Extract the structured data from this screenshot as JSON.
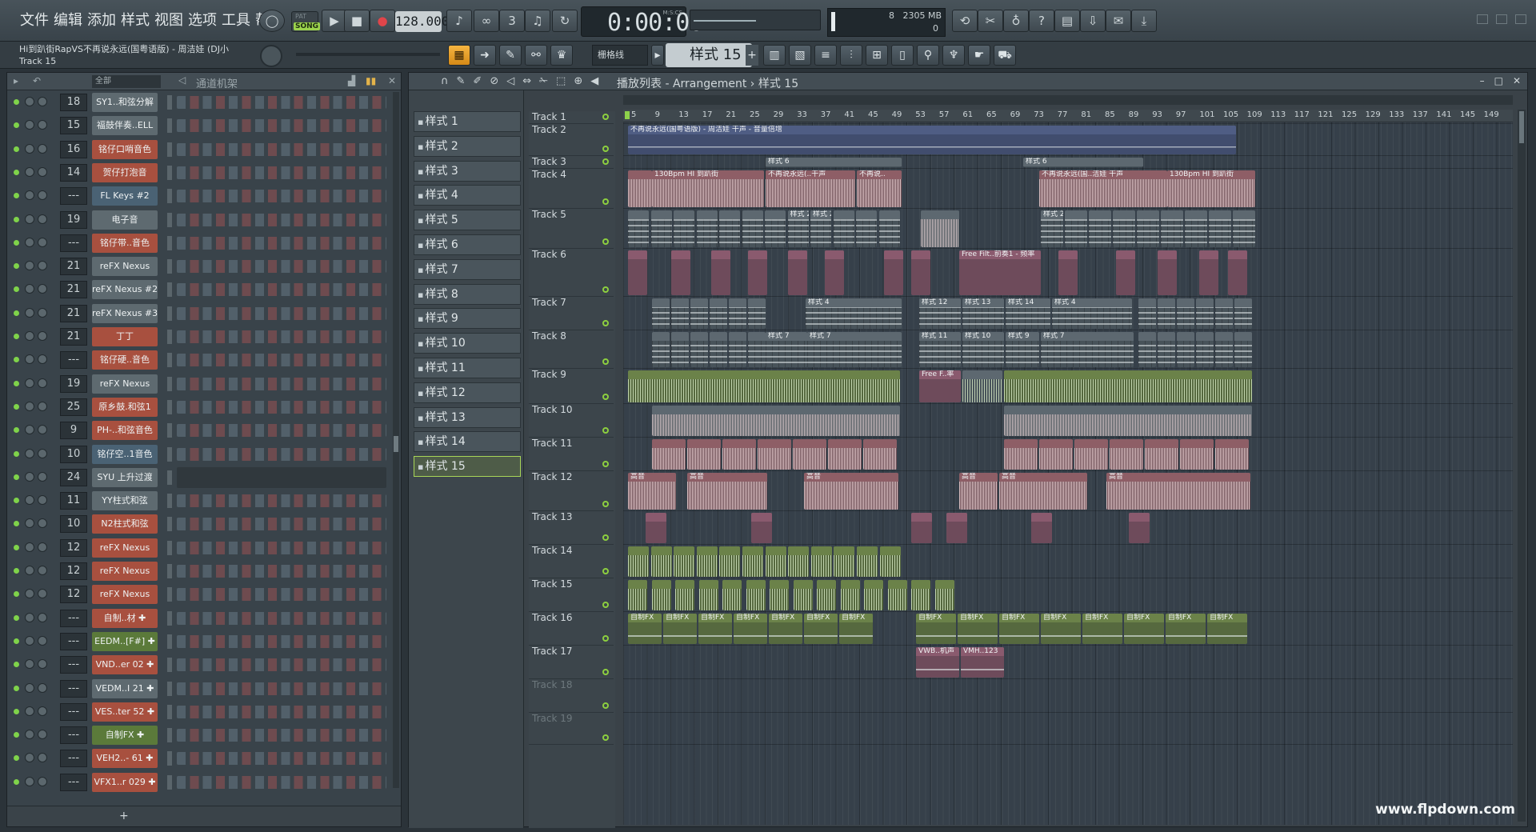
{
  "menu": [
    "文件",
    "编辑",
    "添加",
    "样式",
    "视图",
    "选项",
    "工具",
    "帮助"
  ],
  "transport": {
    "song_label": "SONG",
    "pat_label": "PAT",
    "tempo": "128.000",
    "time": "0:00:00",
    "time_unit": "M:S:CS"
  },
  "meter": {
    "cpu": "8",
    "memory": "2305 MB",
    "poly": "0"
  },
  "hint": {
    "line1": "Hi到趴街RapVS不再说永远(国粤语版) - 周洁娃 (DJ小",
    "line2": "Track 15"
  },
  "toolbar": {
    "snap": "栅格线",
    "pattern": "样式 15"
  },
  "rack": {
    "filter": "全部",
    "title": "通道机架"
  },
  "channels": [
    {
      "num": "18",
      "name": "SY1..和弦分解",
      "color": "#5e6a70"
    },
    {
      "num": "15",
      "name": "福鼓伴奏..ELL",
      "color": "#5e6a70"
    },
    {
      "num": "16",
      "name": "铭仔口哨音色",
      "color": "#a8503f"
    },
    {
      "num": "14",
      "name": "贺仔打泡音",
      "color": "#a8503f"
    },
    {
      "num": "---",
      "name": "FL Keys #2",
      "color": "#4a6274"
    },
    {
      "num": "19",
      "name": "电子音",
      "color": "#5e6a70"
    },
    {
      "num": "---",
      "name": "铭仔带..音色",
      "color": "#a8503f"
    },
    {
      "num": "21",
      "name": "reFX Nexus",
      "color": "#5e6a70"
    },
    {
      "num": "21",
      "name": "reFX Nexus #2",
      "color": "#5e6a70"
    },
    {
      "num": "21",
      "name": "reFX Nexus #3",
      "color": "#5e6a70"
    },
    {
      "num": "21",
      "name": "丁丁",
      "color": "#a8503f"
    },
    {
      "num": "---",
      "name": "铭仔硬..音色",
      "color": "#a8503f"
    },
    {
      "num": "19",
      "name": "reFX Nexus",
      "color": "#5e6a70"
    },
    {
      "num": "25",
      "name": "原乡鼓.和弦1",
      "color": "#a8503f"
    },
    {
      "num": "9",
      "name": "PH-..和弦音色",
      "color": "#a8503f"
    },
    {
      "num": "10",
      "name": "铭仔空..1音色",
      "color": "#4a6274"
    },
    {
      "num": "24",
      "name": "SYU 上升过渡",
      "color": "#5e6a70"
    },
    {
      "num": "11",
      "name": "YY柱式和弦",
      "color": "#5e6a70"
    },
    {
      "num": "10",
      "name": "N2柱式和弦",
      "color": "#a8503f"
    },
    {
      "num": "12",
      "name": "reFX Nexus",
      "color": "#a8503f"
    },
    {
      "num": "12",
      "name": "reFX Nexus",
      "color": "#a8503f"
    },
    {
      "num": "12",
      "name": "reFX Nexus",
      "color": "#a8503f"
    },
    {
      "num": "---",
      "name": "自制..材 ✚",
      "color": "#a8503f"
    },
    {
      "num": "---",
      "name": "EEDM..[F#] ✚",
      "color": "#5b7a3a"
    },
    {
      "num": "---",
      "name": "VND..er 02 ✚",
      "color": "#a8503f"
    },
    {
      "num": "---",
      "name": "VEDM..I 21 ✚",
      "color": "#5e6a70"
    },
    {
      "num": "---",
      "name": "VES..ter 52 ✚",
      "color": "#a8503f"
    },
    {
      "num": "---",
      "name": "自制FX ✚",
      "color": "#5b7a3a"
    },
    {
      "num": "---",
      "name": "VEH2..- 61 ✚",
      "color": "#a8503f"
    },
    {
      "num": "---",
      "name": "VFX1..r 029 ✚",
      "color": "#a8503f"
    }
  ],
  "playlist": {
    "title": "播放列表 - Arrangement › 样式 15"
  },
  "patterns": [
    "样式 1",
    "样式 2",
    "样式 3",
    "样式 4",
    "样式 5",
    "样式 6",
    "样式 7",
    "样式 8",
    "样式 9",
    "样式 10",
    "样式 11",
    "样式 12",
    "样式 13",
    "样式 14",
    "样式 15"
  ],
  "ruler": [
    "5",
    "9",
    "13",
    "17",
    "21",
    "25",
    "29",
    "33",
    "37",
    "41",
    "45",
    "49",
    "53",
    "57",
    "61",
    "65",
    "69",
    "73",
    "77",
    "81",
    "85",
    "89",
    "93",
    "97",
    "101",
    "105",
    "109",
    "113",
    "117",
    "121",
    "125",
    "129",
    "133",
    "137",
    "141",
    "145",
    "149"
  ],
  "tracks": [
    "Track 1",
    "Track 2",
    "Track 3",
    "Track 4",
    "Track 5",
    "Track 6",
    "Track 7",
    "Track 8",
    "Track 9",
    "Track 10",
    "Track 11",
    "Track 12",
    "Track 13",
    "Track 14",
    "Track 15",
    "Track 16",
    "Track 17",
    "Track 18",
    "Track 19"
  ],
  "clip_labels": {
    "t1": "✕不再说永远(国粤语版) - 周洁娃",
    "t2": "不再说永远(国粤语版) - 周洁娃 干声 - 音量倍增",
    "t3": "样式 6",
    "t4a": "130Bpm HI 到趴街",
    "t4b": "不再说永远(..干声",
    "t4c": "不再说..",
    "t4d": "不再说永远(国..洁娃 干声",
    "t4e": "130Bpm HI 到趴街",
    "t5": "样式 2",
    "t6": "Free Filt..前奏1 - 频率",
    "t7": "样式 4",
    "t7b": "样式 12",
    "t7c": "样式 13",
    "t7d": "样式 14",
    "t8": "样式 7",
    "t8b": "样式 11",
    "t8c": "样式 10",
    "t8d": "样式 9",
    "t9": "Free F..率",
    "t12": "高音",
    "t16": "自制FX",
    "t17a": "VWB..机声",
    "t17b": "VMH..123"
  },
  "watermark": "www.flpdown.com"
}
